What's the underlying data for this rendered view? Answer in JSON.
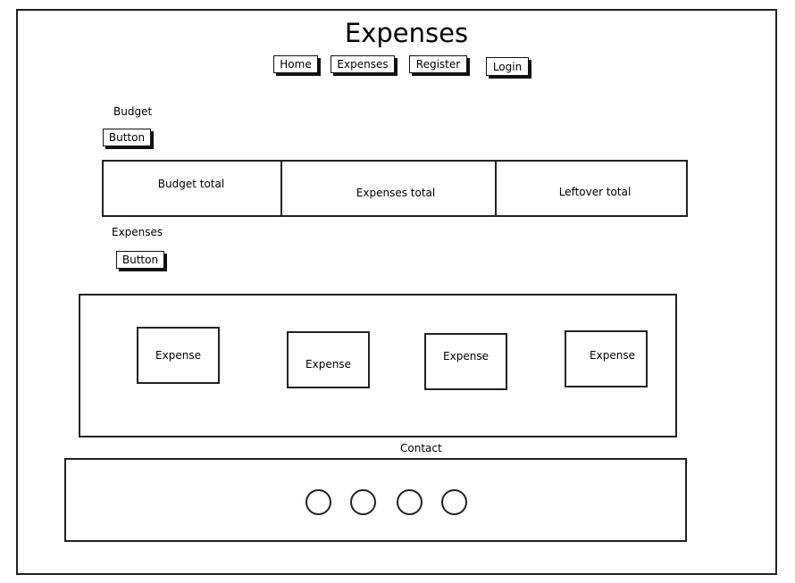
{
  "header": {
    "title": "Expenses"
  },
  "nav": [
    {
      "label": "Home"
    },
    {
      "label": "Expenses"
    },
    {
      "label": "Register"
    },
    {
      "label": "Login"
    }
  ],
  "budget": {
    "heading": "Budget",
    "button_label": "Button",
    "totals": [
      {
        "label": "Budget total"
      },
      {
        "label": "Expenses total"
      },
      {
        "label": "Leftover total"
      }
    ]
  },
  "expenses": {
    "heading": "Expenses",
    "button_label": "Button",
    "cards": [
      {
        "label": "Expense"
      },
      {
        "label": "Expense"
      },
      {
        "label": "Expense"
      },
      {
        "label": "Expense"
      }
    ]
  },
  "contact": {
    "heading": "Contact",
    "icons": [
      "circle-icon",
      "circle-icon",
      "circle-icon",
      "circle-icon"
    ]
  }
}
